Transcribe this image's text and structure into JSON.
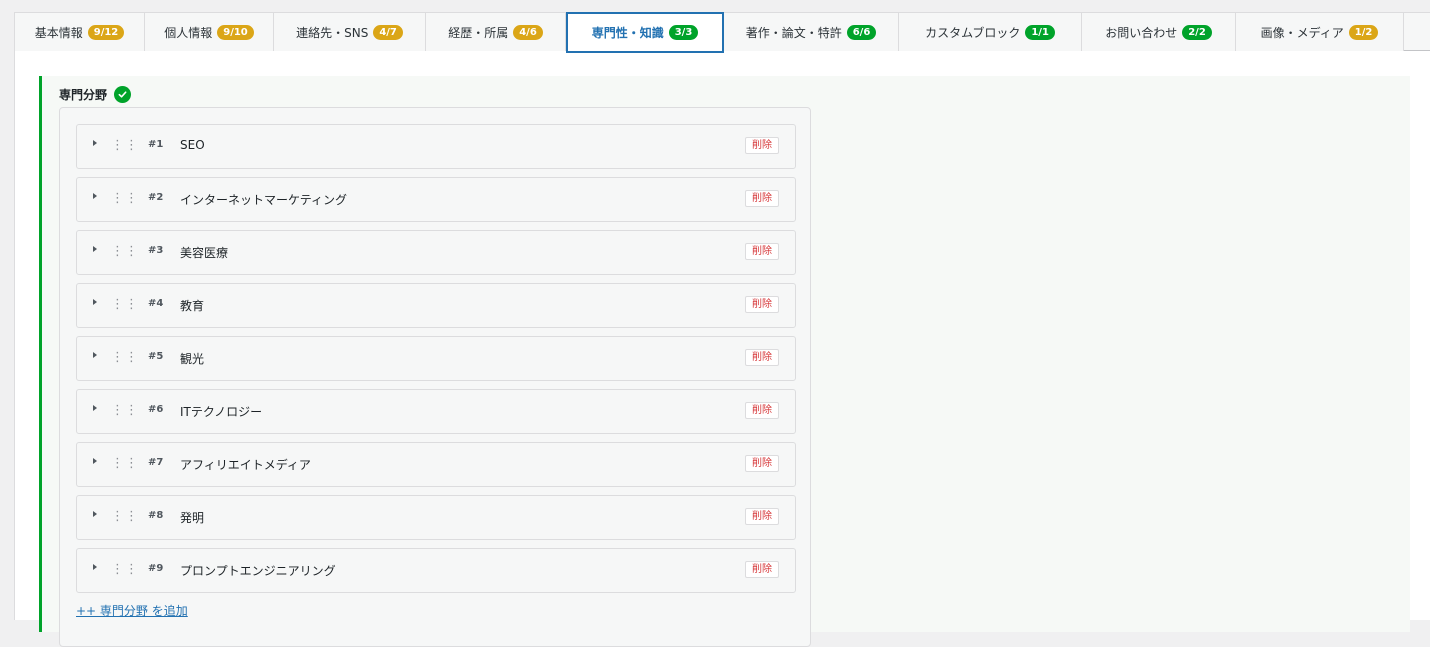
{
  "tabs": [
    {
      "label": "基本情報",
      "badge": "9/12",
      "status": "partial",
      "width": 130
    },
    {
      "label": "個人情報",
      "badge": "9/10",
      "status": "partial",
      "width": 129
    },
    {
      "label": "連絡先・SNS",
      "badge": "4/7",
      "status": "partial",
      "width": 152
    },
    {
      "label": "経歴・所属",
      "badge": "4/6",
      "status": "partial",
      "width": 140
    },
    {
      "label": "専門性・知識",
      "badge": "3/3",
      "status": "complete",
      "width": 158,
      "active": true
    },
    {
      "label": "著作・論文・特許",
      "badge": "6/6",
      "status": "complete",
      "width": 175
    },
    {
      "label": "カスタムブロック",
      "badge": "1/1",
      "status": "complete",
      "width": 183
    },
    {
      "label": "お問い合わせ",
      "badge": "2/2",
      "status": "complete",
      "width": 154
    },
    {
      "label": "画像・メディア",
      "badge": "1/2",
      "status": "partial",
      "width": 168
    }
  ],
  "section": {
    "title": "専門分野"
  },
  "items": [
    {
      "num": "#1",
      "label": "SEO"
    },
    {
      "num": "#2",
      "label": "インターネットマーケティング"
    },
    {
      "num": "#3",
      "label": "美容医療"
    },
    {
      "num": "#4",
      "label": "教育"
    },
    {
      "num": "#5",
      "label": "観光"
    },
    {
      "num": "#6",
      "label": "ITテクノロジー"
    },
    {
      "num": "#7",
      "label": "アフィリエイトメディア"
    },
    {
      "num": "#8",
      "label": "発明"
    },
    {
      "num": "#9",
      "label": "プロンプトエンジニアリング"
    }
  ],
  "delete_label": "削除",
  "add_label": "++ 専門分野 を追加",
  "colors": {
    "accent": "#2271b1",
    "complete": "#00a32a",
    "partial": "#dba617",
    "danger": "#d63638"
  }
}
